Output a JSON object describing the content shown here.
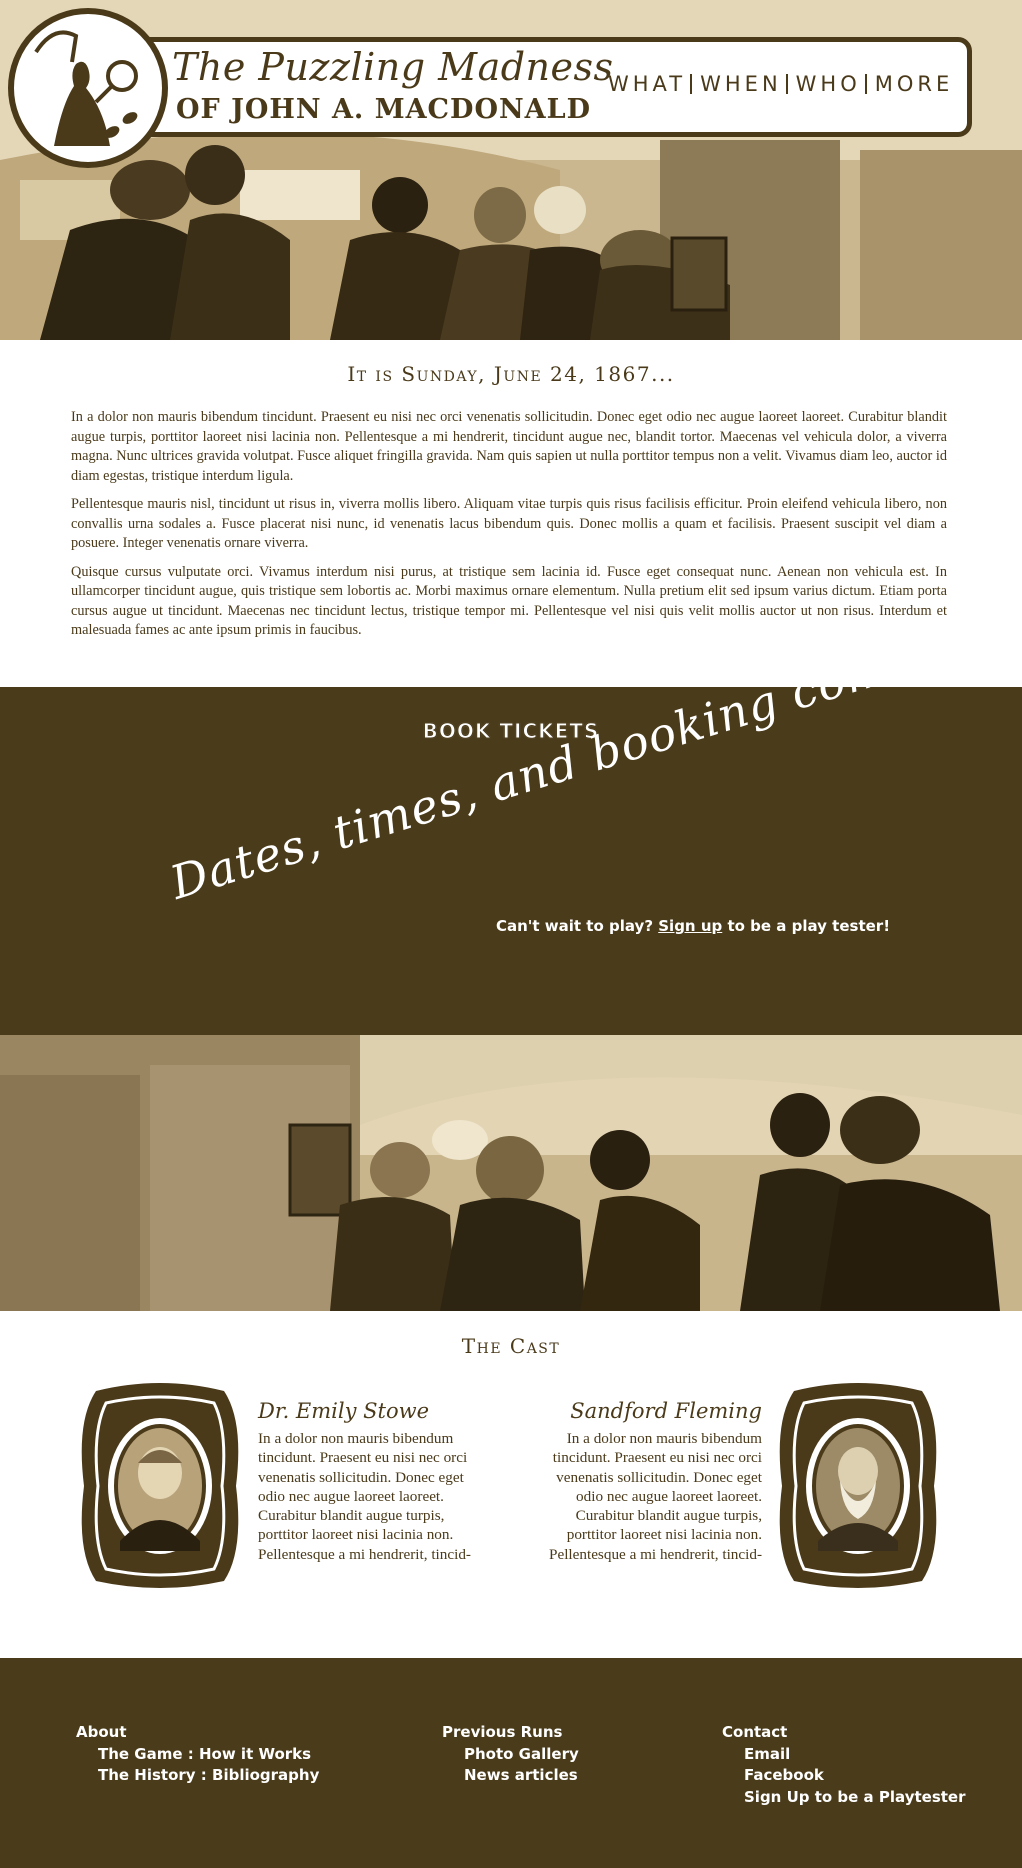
{
  "header": {
    "title_line1": "The Puzzling Madness",
    "title_line2": "OF JOHN A. MACDONALD",
    "nav": [
      "WHAT",
      "WHEN",
      "WHO",
      "MORE"
    ]
  },
  "intro": {
    "heading": "It is Sunday, June 24, 1867...",
    "paragraphs": [
      "In a dolor non mauris bibendum tincidunt. Praesent eu nisi nec orci venenatis sollicitudin. Donec eget odio nec augue laoreet laoreet. Curabitur blandit augue turpis, porttitor laoreet nisi lacinia non. Pellentesque a mi hendrerit, tincidunt augue nec, blandit tortor. Maecenas vel vehicula dolor, a viverra magna. Nunc ultrices gravida volutpat. Fusce aliquet fringilla gravida. Nam quis sapien ut nulla porttitor tempus non a velit. Vivamus diam leo, auctor id diam egestas, tristique interdum ligula.",
      "Pellentesque mauris nisl, tincidunt ut risus in, viverra mollis libero. Aliquam vitae turpis quis risus facilisis efficitur. Proin eleifend vehicula libero, non convallis urna sodales a. Fusce placerat nisi nunc, id venenatis lacus bibendum quis. Donec mollis a quam et facilisis. Praesent suscipit vel diam a posuere. Integer venenatis ornare viverra.",
      "Quisque cursus vulputate orci. Vivamus interdum nisi purus, at tristique sem lacinia id. Fusce eget consequat nunc. Aenean non vehicula est. In ullamcorper tincidunt augue, quis tristique sem lobortis ac. Morbi maximus ornare elementum. Nulla pretium elit sed ipsum varius dictum. Etiam porta cursus augue ut tincidunt. Maecenas nec tincidunt lectus, tristique tempor mi. Pellentesque vel nisi quis velit mollis auctor ut non risus. Interdum et malesuada fames ac ante ipsum primis in faucibus."
    ]
  },
  "tickets": {
    "title": "BOOK TICKETS",
    "coming_soon": "Dates, times, and booking coming soon!",
    "playtest_prefix": "Can't wait to play? ",
    "playtest_link": "Sign up",
    "playtest_suffix": " to be a play tester!"
  },
  "cast": {
    "heading": "The Cast",
    "members": [
      {
        "name": "Dr. Emily Stowe",
        "bio": "In a dolor non mauris bibendum tincidunt. Praesent eu nisi nec orci venenatis sollicitudin. Donec eget odio nec augue laoreet laoreet. Curabitur blandit augue turpis, porttitor laoreet nisi lacinia non. Pellentesque a mi hendrerit, tincid-"
      },
      {
        "name": "Sandford Fleming",
        "bio": "In a dolor non mauris bibendum tincidunt. Praesent eu nisi nec orci venenatis sollicitudin. Donec eget odio nec augue laoreet laoreet. Curabitur blandit augue turpis, porttitor laoreet nisi lacinia non. Pellentesque a mi hendrerit, tincid-"
      }
    ]
  },
  "footer": {
    "about": {
      "heading": "About",
      "links": [
        "The Game : How it Works",
        "The History : Bibliography"
      ]
    },
    "previous": {
      "heading": "Previous Runs",
      "links": [
        "Photo Gallery",
        "News articles"
      ]
    },
    "contact": {
      "heading": "Contact",
      "links": [
        "Email",
        "Facebook",
        "Sign Up to be a Playtester"
      ]
    }
  },
  "colors": {
    "brown": "#4a3b1a",
    "sepia_light": "#d8c9a3",
    "white": "#ffffff"
  }
}
